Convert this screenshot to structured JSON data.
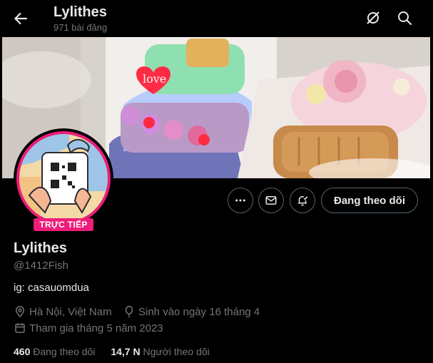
{
  "header": {
    "title": "Lylithes",
    "post_count": "971 bài đăng"
  },
  "icons": {
    "back": "arrow-left-icon",
    "grok": "grok-icon",
    "search": "search-icon",
    "more": "more-horizontal-icon",
    "message": "envelope-icon",
    "notify": "bell-check-icon",
    "location": "location-pin-icon",
    "birthday": "balloon-icon",
    "joined": "calendar-icon"
  },
  "profile": {
    "live_badge": "TRỰC TIẾP",
    "follow_button": "Đang theo dõi",
    "display_name": "Lylithes",
    "handle": "@1412Fish",
    "bio": "ig: casauomdua",
    "location": "Hà Nội, Việt Nam",
    "birthday": "Sinh vào ngày 16 tháng 4",
    "joined": "Tham gia tháng 5 năm 2023",
    "following_count": "460",
    "following_label": "Đang theo dõi",
    "followers_count": "14,7 N",
    "followers_label": "Người theo dõi"
  },
  "banner": {
    "cake_text": "love"
  },
  "colors": {
    "accent_pink": "#ee1c7a",
    "muted": "#71767b",
    "text": "#e7e9ea",
    "border": "#536471"
  }
}
